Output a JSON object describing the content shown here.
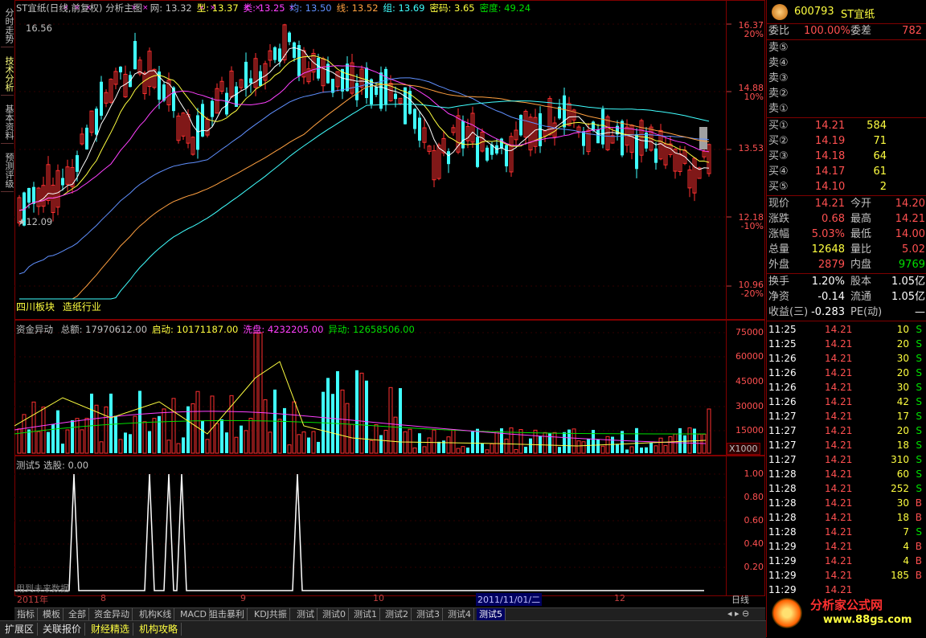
{
  "left_tabs": [
    "分时走势",
    "技术分析",
    "基本资料",
    "预测评级"
  ],
  "main_header": {
    "title": "ST宜纸(日线,前复权) 分析主图",
    "items": [
      {
        "label": "网: 13.32",
        "color": "#c0c0c0"
      },
      {
        "label": "型: 13.37",
        "color": "#ffff40"
      },
      {
        "label": "类: 13.25",
        "color": "#ff40ff"
      },
      {
        "label": "均: 13.50",
        "color": "#6090ff"
      },
      {
        "label": "线: 13.52",
        "color": "#ffa040"
      },
      {
        "label": "组: 13.69",
        "color": "#40ffff"
      },
      {
        "label": "密码: 3.65",
        "color": "#ffff40"
      },
      {
        "label": "密度: 49.24",
        "color": "#00e000"
      }
    ]
  },
  "price_axis": [
    {
      "value": "16.37",
      "pct": "20%"
    },
    {
      "value": "14.88",
      "pct": "10%"
    },
    {
      "value": "13.53",
      "pct": ""
    },
    {
      "value": "12.18",
      "pct": "-10%"
    },
    {
      "value": "10.96",
      "pct": "-20%"
    }
  ],
  "annotations": {
    "high": "16.56",
    "low": "12.09",
    "sector": "四川板块",
    "industry": "造纸行业"
  },
  "volume_header": {
    "name": "资金异动",
    "items": [
      {
        "label": "总额: 17970612.00",
        "color": "#c0c0c0"
      },
      {
        "label": "启动: 10171187.00",
        "color": "#ffff40"
      },
      {
        "label": "洗盘: 4232205.00",
        "color": "#ff40ff"
      },
      {
        "label": "异动: 12658506.00",
        "color": "#00e000"
      }
    ]
  },
  "volume_axis": [
    "75000",
    "60000",
    "45000",
    "30000",
    "15000"
  ],
  "volume_unit": "X1000",
  "signal_header": "测试5 选股: 0.00",
  "signal_axis": [
    "1.00",
    "0.80",
    "0.60",
    "0.40",
    "0.20"
  ],
  "signal_footnote": "用到未来数据",
  "date_axis": [
    "2011年",
    "8",
    "9",
    "10",
    "2011/11/01/二",
    "12"
  ],
  "period": "日线",
  "tabs": [
    "指标",
    "模板",
    "全部",
    "资金异动",
    "机构K线",
    "MACD",
    "狙击暴利",
    "KDJ共振",
    "测试",
    "测试0",
    "测试1",
    "测试2",
    "测试3",
    "测试4",
    "测试5"
  ],
  "active_tab": "测试5",
  "footer_tabs": [
    "扩展区",
    "关联报价",
    "财经精选",
    "机构攻略"
  ],
  "stock": {
    "code": "600793",
    "name": "ST宜纸",
    "watermark": "分析家公式网 www.88gs.com"
  },
  "weibi": {
    "label": "委比",
    "value": "100.00%",
    "label2": "委差",
    "value2": "782"
  },
  "sells": [
    {
      "label": "卖⑤",
      "price": "",
      "vol": ""
    },
    {
      "label": "卖④",
      "price": "",
      "vol": ""
    },
    {
      "label": "卖③",
      "price": "",
      "vol": ""
    },
    {
      "label": "卖②",
      "price": "",
      "vol": ""
    },
    {
      "label": "卖①",
      "price": "",
      "vol": ""
    }
  ],
  "buys": [
    {
      "label": "买①",
      "price": "14.21",
      "vol": "584"
    },
    {
      "label": "买②",
      "price": "14.19",
      "vol": "71"
    },
    {
      "label": "买③",
      "price": "14.18",
      "vol": "64"
    },
    {
      "label": "买④",
      "price": "14.17",
      "vol": "61"
    },
    {
      "label": "买⑤",
      "price": "14.10",
      "vol": "2"
    }
  ],
  "quote": [
    {
      "l1": "现价",
      "v1": "14.21",
      "c1": "#ff5050",
      "l2": "今开",
      "v2": "14.20",
      "c2": "#ff5050"
    },
    {
      "l1": "涨跌",
      "v1": "0.68",
      "c1": "#ff5050",
      "l2": "最高",
      "v2": "14.21",
      "c2": "#ff5050"
    },
    {
      "l1": "涨幅",
      "v1": "5.03%",
      "c1": "#ff5050",
      "l2": "最低",
      "v2": "14.00",
      "c2": "#ff5050"
    },
    {
      "l1": "总量",
      "v1": "12648",
      "c1": "#ffff40",
      "l2": "量比",
      "v2": "5.02",
      "c2": "#ff5050"
    },
    {
      "l1": "外盘",
      "v1": "2879",
      "c1": "#ff5050",
      "l2": "内盘",
      "v2": "9769",
      "c2": "#00e000"
    }
  ],
  "fundamentals": [
    {
      "l1": "换手",
      "v1": "1.20%",
      "l2": "股本",
      "v2": "1.05亿"
    },
    {
      "l1": "净资",
      "v1": "-0.14",
      "l2": "流通",
      "v2": "1.05亿"
    },
    {
      "l1": "收益(三)",
      "v1": "-0.283",
      "l2": "PE(动)",
      "v2": "—"
    }
  ],
  "ticks": [
    {
      "time": "11:25",
      "price": "14.21",
      "vol": "10",
      "side": "S"
    },
    {
      "time": "11:25",
      "price": "14.21",
      "vol": "20",
      "side": "S"
    },
    {
      "time": "11:26",
      "price": "14.21",
      "vol": "30",
      "side": "S"
    },
    {
      "time": "11:26",
      "price": "14.21",
      "vol": "20",
      "side": "S"
    },
    {
      "time": "11:26",
      "price": "14.21",
      "vol": "30",
      "side": "S"
    },
    {
      "time": "11:26",
      "price": "14.21",
      "vol": "42",
      "side": "S"
    },
    {
      "time": "11:27",
      "price": "14.21",
      "vol": "17",
      "side": "S"
    },
    {
      "time": "11:27",
      "price": "14.21",
      "vol": "20",
      "side": "S"
    },
    {
      "time": "11:27",
      "price": "14.21",
      "vol": "18",
      "side": "S"
    },
    {
      "time": "11:27",
      "price": "14.21",
      "vol": "310",
      "side": "S"
    },
    {
      "time": "11:28",
      "price": "14.21",
      "vol": "60",
      "side": "S"
    },
    {
      "time": "11:28",
      "price": "14.21",
      "vol": "252",
      "side": "S"
    },
    {
      "time": "11:28",
      "price": "14.21",
      "vol": "30",
      "side": "B"
    },
    {
      "time": "11:28",
      "price": "14.21",
      "vol": "18",
      "side": "B"
    },
    {
      "time": "11:28",
      "price": "14.21",
      "vol": "7",
      "side": "S"
    },
    {
      "time": "11:29",
      "price": "14.21",
      "vol": "4",
      "side": "B"
    },
    {
      "time": "11:29",
      "price": "14.21",
      "vol": "4",
      "side": "B"
    },
    {
      "time": "11:29",
      "price": "14.21",
      "vol": "185",
      "side": "B"
    },
    {
      "time": "11:29",
      "price": "14.21",
      "vol": "",
      "side": ""
    }
  ],
  "colors": {
    "up": "#ff3030",
    "down": "#40ffff",
    "frame": "#800000",
    "grid": "#600000"
  }
}
